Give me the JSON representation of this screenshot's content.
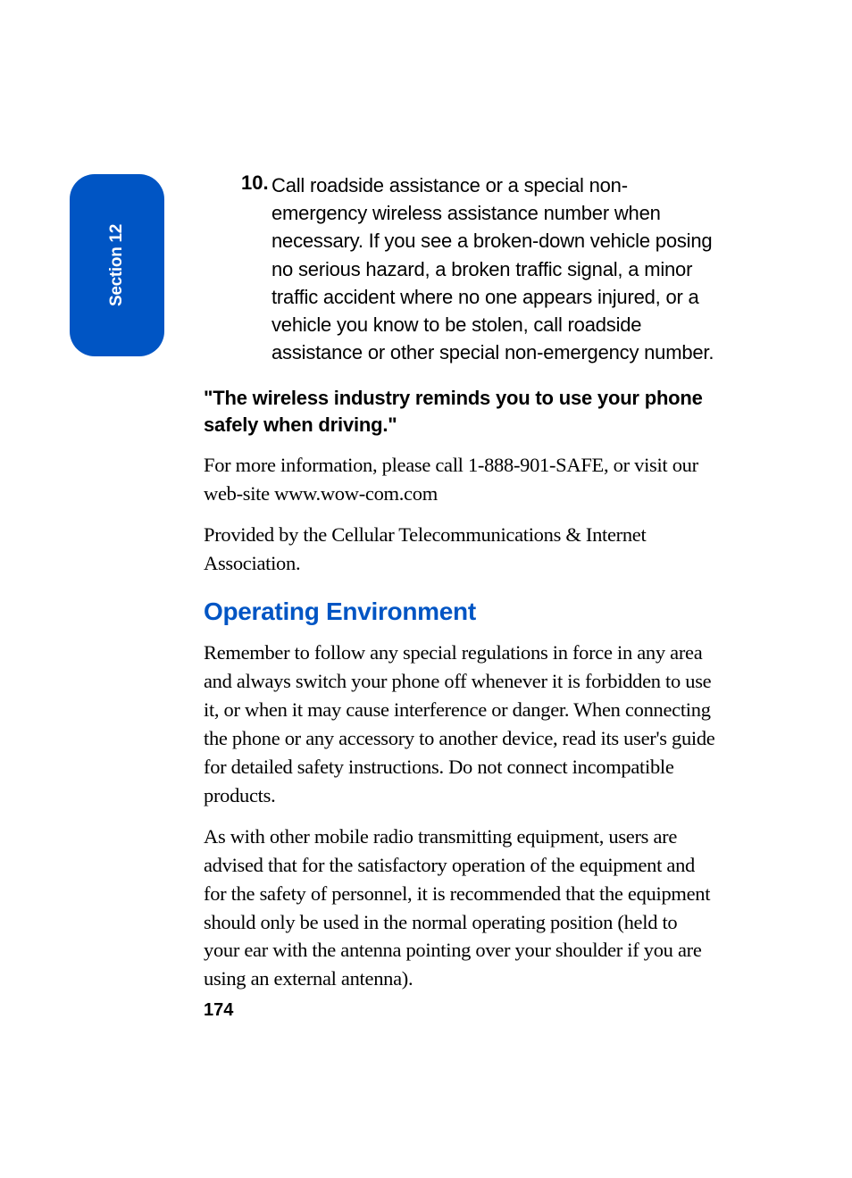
{
  "section_tab": {
    "label": "Section 12"
  },
  "list_item": {
    "number": "10.",
    "text": "Call roadside assistance or a special non-emergency wireless assistance number when necessary. If you see a broken-down vehicle posing no serious hazard, a broken traffic signal, a minor traffic accident where no one appears injured, or a vehicle you know to be stolen, call roadside assistance or other special non-emergency number."
  },
  "quote": "\"The wireless industry reminds you to use your phone safely when driving.\"",
  "info_text": "For more information, please call 1-888-901-SAFE, or visit our web-site www.wow-com.com",
  "provider_text": "Provided by the Cellular Telecommunications & Internet Association.",
  "heading": "Operating Environment",
  "body_para_1": "Remember to follow any special regulations in force in any area and always switch your phone off whenever it is forbidden to use it, or when it may cause interference or danger. When connecting the phone or any accessory to another device, read its user's guide for detailed safety instructions. Do not connect incompatible products.",
  "body_para_2": "As with other mobile radio transmitting equipment, users are advised that for the satisfactory operation of the equipment and for the safety of personnel, it is recommended that the equipment should only be used in the normal operating position (held to your ear with the antenna pointing over your shoulder if you are using an external antenna).",
  "page_number": "174"
}
